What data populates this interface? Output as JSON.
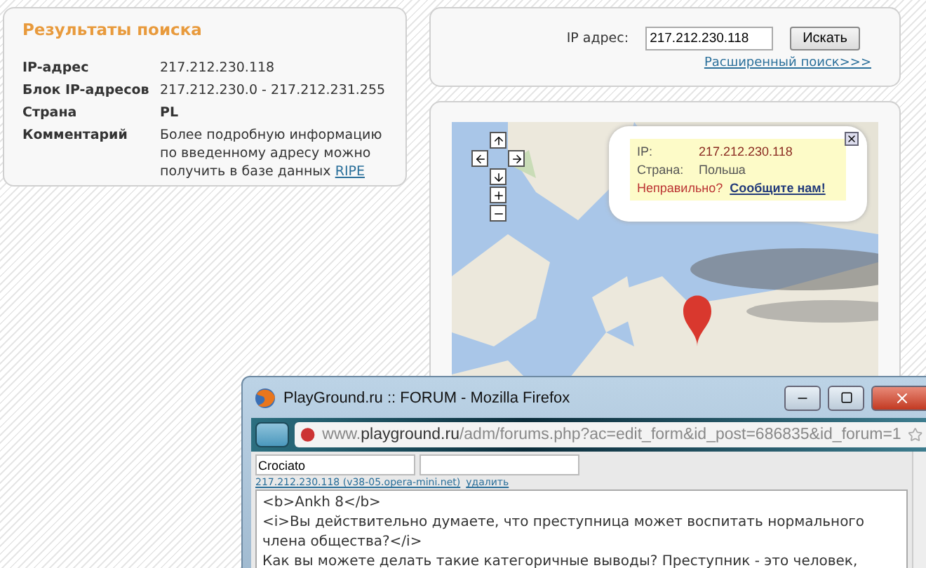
{
  "results": {
    "title": "Результаты поиска",
    "rows": [
      {
        "kind": "text",
        "label": "IP-адрес",
        "value": "217.212.230.118"
      },
      {
        "kind": "text",
        "label": "Блок IP-адресов",
        "value": "217.212.230.0 - 217.212.231.255"
      },
      {
        "kind": "bold",
        "label": "Страна",
        "value": "PL"
      },
      {
        "kind": "link",
        "label": "Комментарий",
        "value": "Более подробную информацию по введенному адресу можно получить в базе данных",
        "link": "RIPE"
      }
    ]
  },
  "search": {
    "label": "IP адрес:",
    "value": "217.212.230.118",
    "button": "Искать",
    "advanced_link": "Расширенный поиск>>>"
  },
  "map": {
    "kind": "picture",
    "popup": {
      "ip_label": "IP:",
      "ip": "217.212.230.118",
      "country_label": "Страна:",
      "country": "Польша",
      "wrong": "Неправильно?",
      "report": "Сообщите нам!"
    }
  },
  "browser": {
    "title": "PlayGround.ru :: FORUM - Mozilla Firefox",
    "url": "www.**playground.ru**/adm/forums.php?ac=edit_form&id_post=686835&id_forum=1",
    "name_value": "Crociato",
    "ip_link": "217.212.230.118 (v38-05.opera-mini.net)",
    "delete_link": "удалить",
    "message_lines": [
      "<b>Ankh 8</b>",
      "<i>Вы действительно думаете, что преступница может воспитать нормального",
      "члена общества?</i>",
      "Как вы можете делать такие категоричные выводы? Преступник - это человек,"
    ]
  }
}
